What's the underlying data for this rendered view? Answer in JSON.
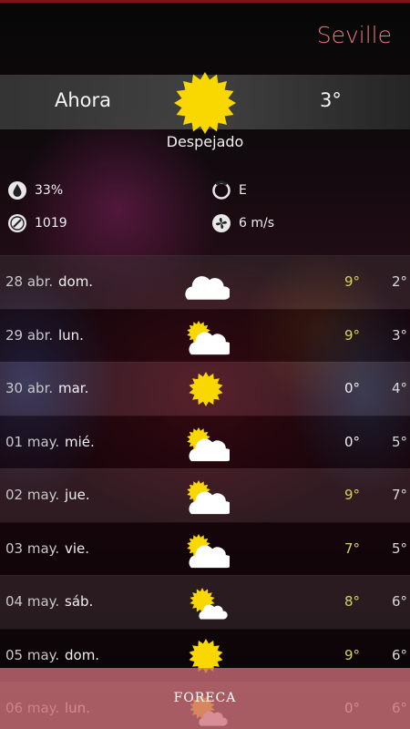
{
  "app": {
    "city": "Seville"
  },
  "current": {
    "label": "Ahora",
    "temperature": "3°",
    "condition": "Despejado",
    "icon": "sun-icon"
  },
  "details": {
    "humidity": "33%",
    "wind_direction": "E",
    "pressure": "1019",
    "wind_speed": "6 m/s"
  },
  "colors": {
    "city": "#e8787b",
    "sun": "#f8d800",
    "hi_warm": "#d8d060",
    "hi_neutral": "#f0f0f0",
    "footer": "#cd6e78"
  },
  "forecast": [
    {
      "date": "28 abr.",
      "day": "dom.",
      "icon": "cloud-icon",
      "hi": "9°",
      "lo": "2°",
      "hi_color": "#d8d060"
    },
    {
      "date": "29 abr.",
      "day": "lun.",
      "icon": "sun-cloud-icon",
      "hi": "9°",
      "lo": "3°",
      "hi_color": "#d8d060"
    },
    {
      "date": "30 abr.",
      "day": "mar.",
      "icon": "sun-icon",
      "hi": "0°",
      "lo": "4°",
      "hi_color": "#f0f0f0"
    },
    {
      "date": "01 may.",
      "day": "mié.",
      "icon": "sun-cloud-icon",
      "hi": "0°",
      "lo": "5°",
      "hi_color": "#f0f0f0"
    },
    {
      "date": "02 may.",
      "day": "jue.",
      "icon": "sun-cloud-icon",
      "hi": "9°",
      "lo": "7°",
      "hi_color": "#d8d060"
    },
    {
      "date": "03 may.",
      "day": "vie.",
      "icon": "sun-cloud-icon",
      "hi": "7°",
      "lo": "5°",
      "hi_color": "#d8d060"
    },
    {
      "date": "04 may.",
      "day": "sáb.",
      "icon": "sun-small-cloud-icon",
      "hi": "8°",
      "lo": "6°",
      "hi_color": "#d8d060"
    },
    {
      "date": "05 may.",
      "day": "dom.",
      "icon": "sun-icon",
      "hi": "9°",
      "lo": "6°",
      "hi_color": "#d8d060"
    },
    {
      "date": "06 may.",
      "day": "lun.",
      "icon": "sun-small-cloud-icon",
      "hi": "0°",
      "lo": "6°",
      "hi_color": "#f0f0f0"
    }
  ],
  "footer": {
    "brand": "FORECA"
  }
}
